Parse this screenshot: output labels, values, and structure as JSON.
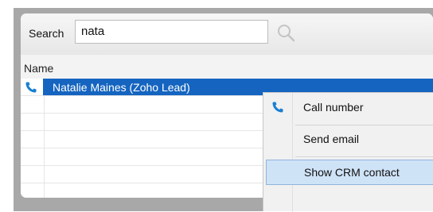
{
  "search": {
    "label": "Search",
    "value": "nata",
    "icon": "search-icon"
  },
  "list": {
    "column_header": "Name",
    "rows": [
      {
        "name": "Natalie Maines (Zoho Lead)",
        "icon": "phone-icon",
        "selected": true
      }
    ]
  },
  "context_menu": {
    "items": [
      {
        "label": "Call number",
        "icon": "phone-icon"
      },
      {
        "label": "Send email"
      },
      {
        "label": "Show CRM contact",
        "highlighted": true
      }
    ]
  },
  "colors": {
    "selection": "#1565c0",
    "menu_highlight": "#cfe3f7",
    "phone_icon": "#1a7fd0",
    "frame": "#a8a8a8"
  }
}
